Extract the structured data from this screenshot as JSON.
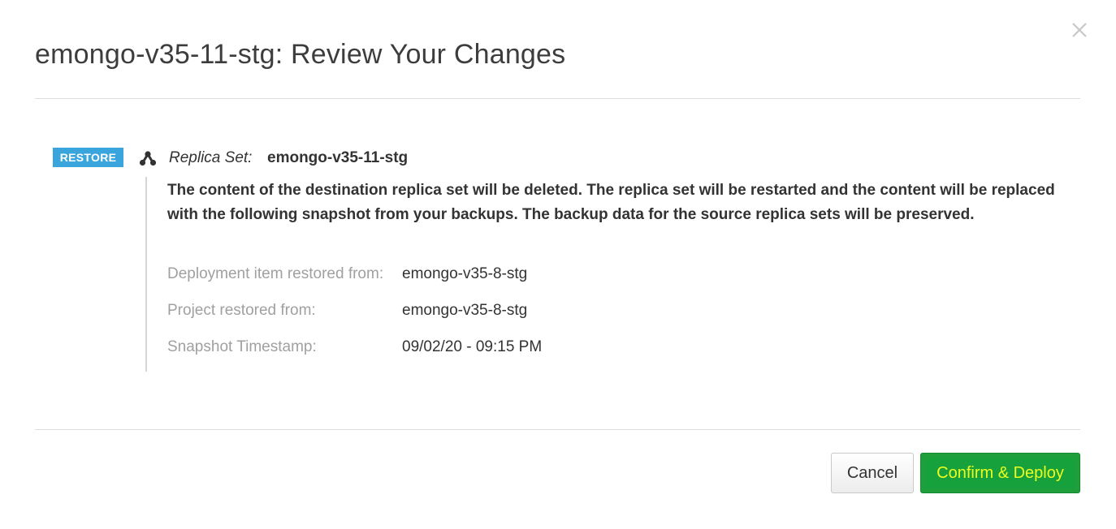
{
  "dialog": {
    "title": "emongo-v35-11-stg: Review Your Changes",
    "close_icon": "close-icon"
  },
  "change": {
    "badge": "RESTORE",
    "badge_color": "#3aa5dd",
    "icon": "replica-set-icon",
    "type_label": "Replica Set:",
    "name": "emongo-v35-11-stg",
    "warning": "The content of the destination replica set will be deleted. The replica set will be restarted and the content will be replaced with the following snapshot from your backups. The backup data for the source replica sets will be preserved.",
    "details": [
      {
        "label": "Deployment item restored from:",
        "value": "emongo-v35-8-stg"
      },
      {
        "label": "Project restored from:",
        "value": "emongo-v35-8-stg"
      },
      {
        "label": "Snapshot Timestamp:",
        "value": "09/02/20 - 09:15 PM"
      }
    ]
  },
  "footer": {
    "cancel_label": "Cancel",
    "confirm_label": "Confirm & Deploy",
    "confirm_color": "#1f9e3c",
    "confirm_text_color": "#ecff1e"
  }
}
